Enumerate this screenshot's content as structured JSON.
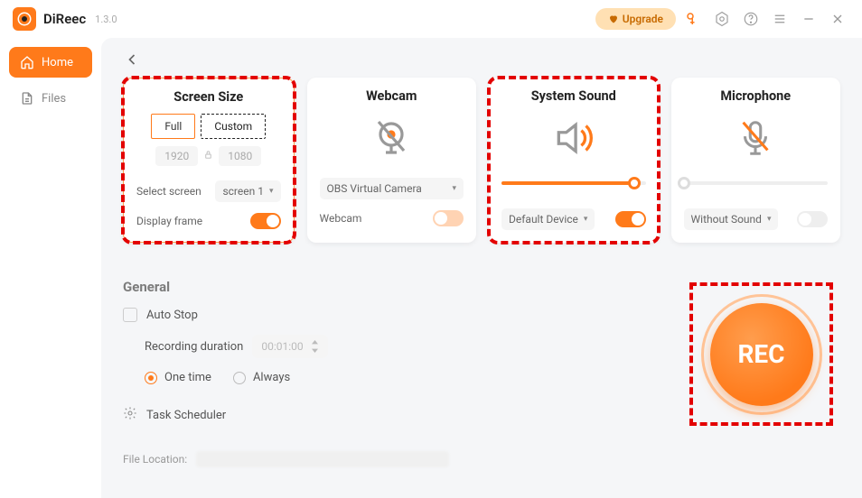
{
  "app": {
    "name": "DiReec",
    "version": "1.3.0"
  },
  "titlebar": {
    "upgrade": "Upgrade"
  },
  "sidebar": {
    "items": [
      {
        "label": "Home"
      },
      {
        "label": "Files"
      }
    ]
  },
  "cards": {
    "screen": {
      "title": "Screen Size",
      "full": "Full",
      "custom": "Custom",
      "w": "1920",
      "h": "1080",
      "select_label": "Select screen",
      "select_value": "screen 1",
      "display_frame": "Display frame"
    },
    "webcam": {
      "title": "Webcam",
      "device": "OBS Virtual Camera",
      "label": "Webcam"
    },
    "sound": {
      "title": "System Sound",
      "device": "Default Device",
      "slider": 92
    },
    "mic": {
      "title": "Microphone",
      "device": "Without Sound",
      "slider": 0
    }
  },
  "general": {
    "title": "General",
    "auto_stop": "Auto Stop",
    "duration_label": "Recording duration",
    "duration_value": "00:01:00",
    "one_time": "One time",
    "always": "Always",
    "task_scheduler": "Task Scheduler",
    "file_location": "File Location:"
  },
  "rec": {
    "label": "REC"
  },
  "colors": {
    "accent": "#ff7a1a",
    "highlight": "#e30000"
  }
}
